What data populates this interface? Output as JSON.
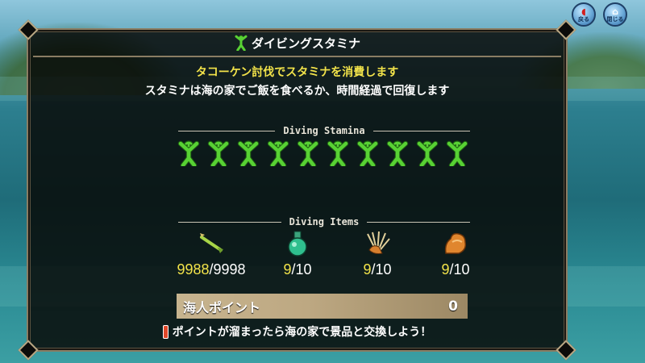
{
  "header": {
    "back_label": "戻る",
    "close_label": "閉じる"
  },
  "panel": {
    "title": "ダイビングスタミナ",
    "title_icon": "green-diver-icon",
    "message_primary": "タコーケン討伐でスタミナを消費します",
    "message_secondary": "スタミナは海の家でご飯を食べるか、時間経過で回復します"
  },
  "stamina": {
    "heading": "Diving Stamina",
    "count": 10,
    "icon": "green-diver-icon"
  },
  "items": {
    "heading": "Diving Items",
    "list": [
      {
        "icon": "harpoon-icon",
        "current": "9988",
        "separator": "/",
        "max": "9998"
      },
      {
        "icon": "potion-icon",
        "current": "9",
        "separator": "/",
        "max": "10"
      },
      {
        "icon": "fan-boot-icon",
        "current": "9",
        "separator": "/",
        "max": "10"
      },
      {
        "icon": "muscle-icon",
        "current": "9",
        "separator": "/",
        "max": "10"
      }
    ]
  },
  "points": {
    "label": "海人ポイント",
    "value": "0"
  },
  "hint": {
    "text": "ポイントが溜まったら海の家で景品と交換しよう！"
  },
  "colors": {
    "accent_yellow": "#f2e34a",
    "stamina_green": "#58d134",
    "panel_border": "#8a7d63",
    "points_bar": "#bda882"
  }
}
